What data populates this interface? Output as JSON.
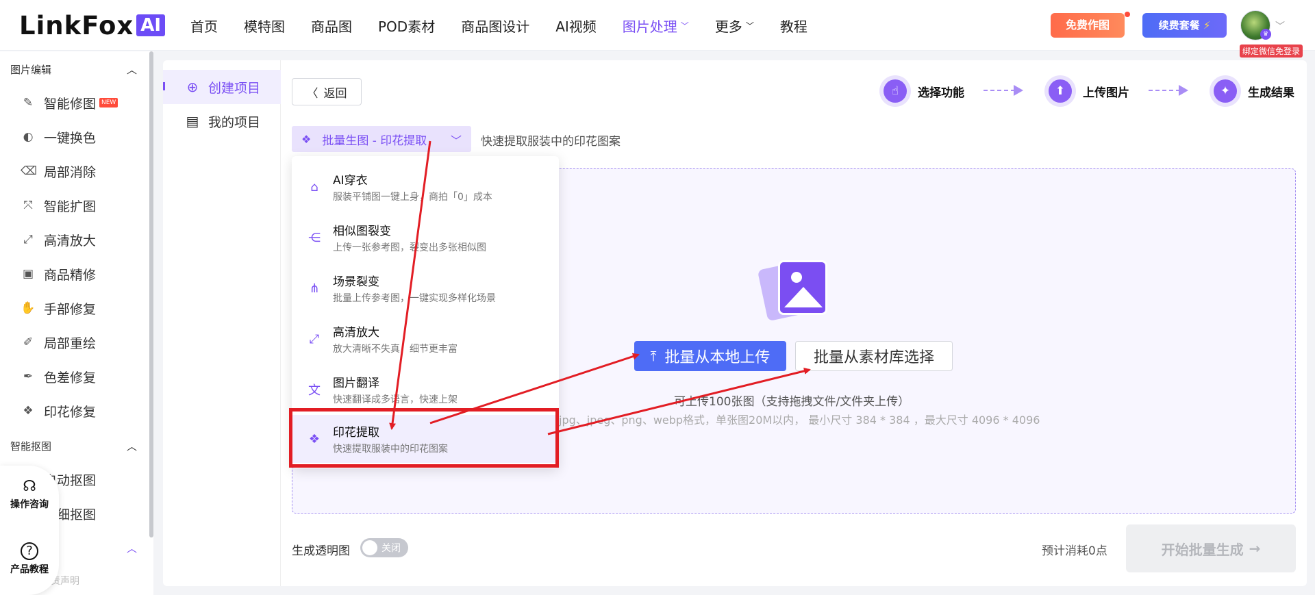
{
  "header": {
    "logo_text": "LinkFox",
    "logo_badge": "AI",
    "nav": [
      {
        "label": "首页"
      },
      {
        "label": "模特图"
      },
      {
        "label": "商品图"
      },
      {
        "label": "POD素材"
      },
      {
        "label": "商品图设计"
      },
      {
        "label": "AI视频"
      },
      {
        "label": "图片处理",
        "caret": "﹀",
        "active": true
      },
      {
        "label": "更多",
        "caret": "﹀"
      },
      {
        "label": "教程"
      }
    ],
    "free_btn": "免费作图",
    "renew_btn": "续费套餐",
    "renew_icon": "⚡",
    "avatar_caret": "﹀",
    "bind_tag": "绑定微信免登录"
  },
  "sidebar": {
    "group1": "图片编辑",
    "group1_caret": "︿",
    "items": [
      {
        "label": "智能修图",
        "icon": "magic-icon",
        "glyph": "✎",
        "badge": "NEW"
      },
      {
        "label": "一键换色",
        "icon": "color-swap-icon",
        "glyph": "◐"
      },
      {
        "label": "局部消除",
        "icon": "eraser-icon",
        "glyph": "⌫"
      },
      {
        "label": "智能扩图",
        "icon": "expand-icon",
        "glyph": "⤧"
      },
      {
        "label": "高清放大",
        "icon": "zoom-icon",
        "glyph": "⤢"
      },
      {
        "label": "商品精修",
        "icon": "retouch-icon",
        "glyph": "▣"
      },
      {
        "label": "手部修复",
        "icon": "hand-icon",
        "glyph": "✋"
      },
      {
        "label": "局部重绘",
        "icon": "repaint-icon",
        "glyph": "✐"
      },
      {
        "label": "色差修复",
        "icon": "color-fix-icon",
        "glyph": "✒"
      },
      {
        "label": "印花修复",
        "icon": "print-fix-icon",
        "glyph": "❖"
      }
    ],
    "group2": "智能抠图",
    "group2_caret": "︿",
    "items2": [
      {
        "label": "自动抠图"
      },
      {
        "label": "精细抠图"
      }
    ],
    "group3_caret": "︿",
    "disclaimer": "免责声明",
    "help": [
      {
        "label": "操作咨询",
        "icon": "headset-icon",
        "glyph": "☊"
      },
      {
        "label": "产品教程",
        "icon": "question-icon",
        "glyph": "?"
      }
    ]
  },
  "subnav": {
    "items": [
      {
        "label": "创建项目",
        "icon": "plus-circle-icon",
        "glyph": "⊕",
        "active": true
      },
      {
        "label": "我的项目",
        "icon": "document-icon",
        "glyph": "▤"
      }
    ]
  },
  "toolbar": {
    "back_label": "返回",
    "back_glyph": "〈"
  },
  "steps": [
    {
      "label": "选择功能",
      "icon": "pointer-icon",
      "glyph": "☝"
    },
    {
      "label": "上传图片",
      "icon": "upload-image-icon",
      "glyph": "⬆"
    },
    {
      "label": "生成结果",
      "icon": "bulb-icon",
      "glyph": "✦"
    }
  ],
  "mode": {
    "selected": "批量生图 - 印花提取",
    "description": "快速提取服装中的印花图案",
    "chevron": "﹀",
    "glyph": "❖"
  },
  "dropdown": [
    {
      "title": "AI穿衣",
      "sub": "服装平铺图一键上身，商拍「0」成本",
      "icon": "shirt-icon",
      "glyph": "⌂"
    },
    {
      "title": "相似图裂变",
      "sub": "上传一张参考图，裂变出多张相似图",
      "icon": "share-icon",
      "glyph": "⋲"
    },
    {
      "title": "场景裂变",
      "sub": "批量上传参考图，一键实现多样化场景",
      "icon": "scene-icon",
      "glyph": "⋔"
    },
    {
      "title": "高清放大",
      "sub": "放大清晰不失真，细节更丰富",
      "icon": "zoom-icon",
      "glyph": "⤢"
    },
    {
      "title": "图片翻译",
      "sub": "快速翻译成多语言，快速上架",
      "icon": "translate-icon",
      "glyph": "文"
    },
    {
      "title": "印花提取",
      "sub": "快速提取服装中的印花图案",
      "icon": "print-extract-icon",
      "glyph": "❖",
      "selected": true
    }
  ],
  "upload": {
    "local_btn": "批量从本地上传",
    "local_glyph": "⤒",
    "library_btn": "批量从素材库选择",
    "hint": "可上传100张图（支持拖拽文件/文件夹上传）",
    "format": "jpg、jpeg、png、webp格式，单张图20M以内， 最小尺寸 384 * 384 ，最大尺寸 4096 * 4096"
  },
  "footer": {
    "transparent_label": "生成透明图",
    "toggle_text": "关闭",
    "toggle_on": false,
    "cost": "预计消耗0点",
    "start_btn": "开始批量生成",
    "start_glyph": "→"
  },
  "colors": {
    "accent": "#7a4ff4",
    "primary_blue": "#4e6cf6",
    "annotation_red": "#e21d24"
  }
}
